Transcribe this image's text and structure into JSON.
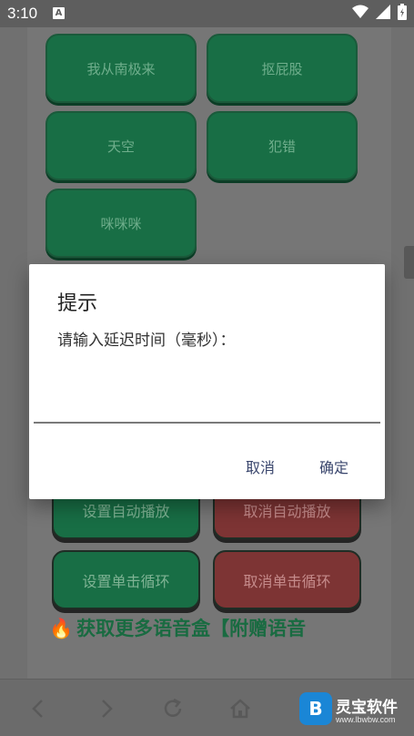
{
  "status_bar": {
    "time": "3:10",
    "notification_badge": "A",
    "icons": [
      "wifi-icon",
      "signal-icon",
      "battery-icon"
    ]
  },
  "sound_buttons": [
    {
      "label": "我从南极来"
    },
    {
      "label": "抠屁股"
    },
    {
      "label": "天空"
    },
    {
      "label": "犯错"
    },
    {
      "label": "咪咪咪"
    }
  ],
  "controls": {
    "set_auto_play": "设置自动播放",
    "cancel_auto_play": "取消自动播放",
    "set_single_loop": "设置单击循环",
    "cancel_single_loop": "取消单击循环"
  },
  "more_link": {
    "icon": "fire-icon",
    "text": "获取更多语音盒【附赠语音"
  },
  "dialog": {
    "title": "提示",
    "message": "请输入延迟时间（毫秒）：",
    "input_value": "",
    "cancel_label": "取消",
    "ok_label": "确定"
  },
  "browser_nav": {
    "icons": [
      "back-icon",
      "forward-icon",
      "refresh-icon",
      "home-icon"
    ]
  },
  "watermark": {
    "name": "灵宝软件",
    "url": "www.lbwbw.com"
  },
  "colors": {
    "green_button": "#186e45",
    "red_button": "#7d3434",
    "dialog_action": "#3a466d"
  }
}
